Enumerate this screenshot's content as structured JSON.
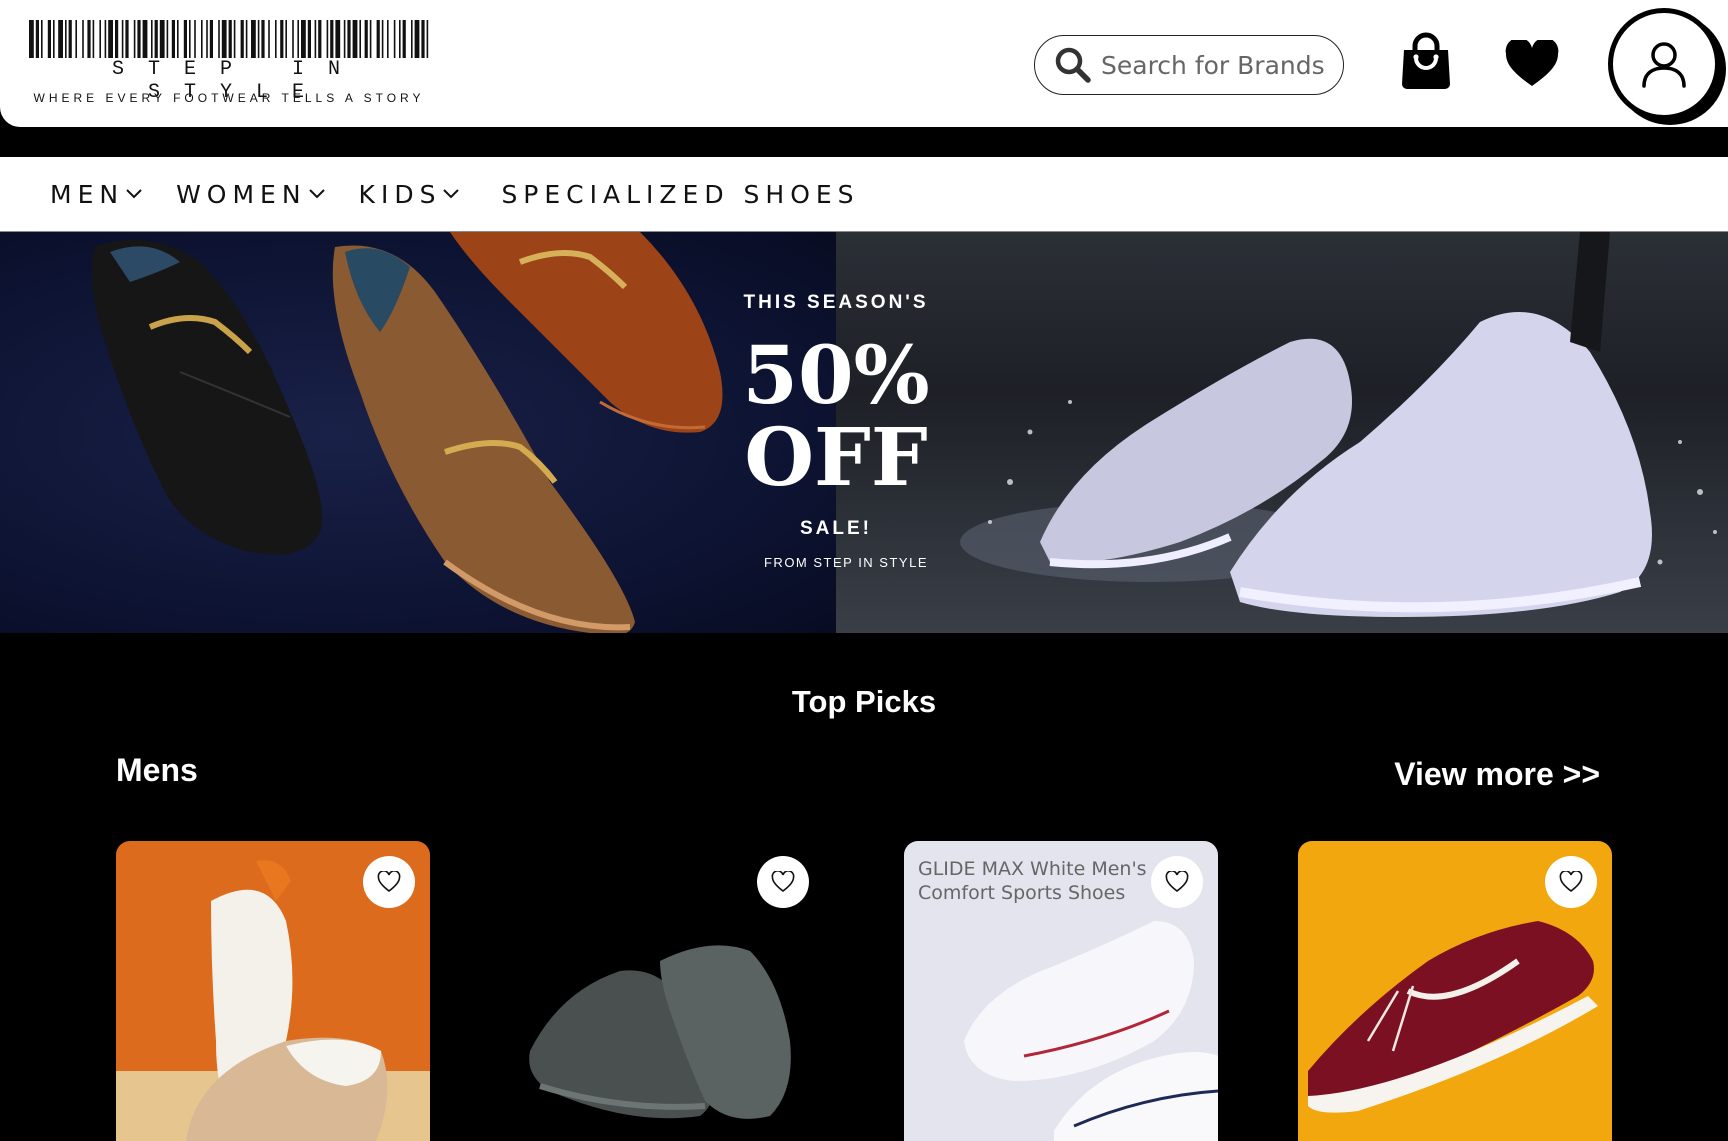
{
  "header": {
    "logo_name": "STEP IN STYLE",
    "logo_tagline": "WHERE EVERY FOOTWEAR TELLS A STORY",
    "search_placeholder": "Search for Brands",
    "icons": [
      "search-icon",
      "shopping-bag-icon",
      "heart-icon",
      "user-icon"
    ]
  },
  "nav": {
    "items": [
      {
        "label": "MEN",
        "has_dropdown": true
      },
      {
        "label": "WOMEN",
        "has_dropdown": true
      },
      {
        "label": "KIDS",
        "has_dropdown": true
      },
      {
        "label": "SPECIALIZED SHOES",
        "has_dropdown": false
      }
    ]
  },
  "banner": {
    "season": "THIS SEASON'S",
    "discount_line1": "50%",
    "discount_line2": "OFF",
    "sale": "SALE!",
    "from": "FROM STEP IN STYLE"
  },
  "top_picks": {
    "title": "Top Picks",
    "section": "Mens",
    "view_more": "View more >>",
    "products": [
      {
        "caption": "",
        "icon": "heart-outline-icon",
        "bg": "#e0701f"
      },
      {
        "caption": "",
        "icon": "heart-outline-icon",
        "bg": "#000000"
      },
      {
        "caption": "GLIDE MAX White Men's Comfort Sports Shoes",
        "icon": "heart-outline-icon",
        "bg": "#e4e4ee"
      },
      {
        "caption": "",
        "icon": "heart-outline-icon",
        "bg": "#f5a80f"
      }
    ]
  },
  "colors": {
    "page_bg": "#000000",
    "header_bg": "#ffffff",
    "text_dark": "#111111",
    "text_light": "#ffffff"
  }
}
